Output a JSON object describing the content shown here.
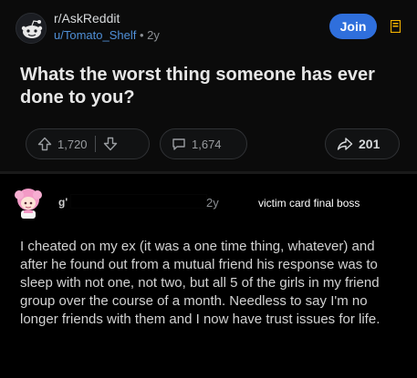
{
  "post": {
    "subreddit": "r/AskReddit",
    "author": "u/Tomato_Shelf",
    "separator": "•",
    "age": "2y",
    "join_label": "Join",
    "title": "Whats the worst thing someone has ever done to you?",
    "upvotes": "1,720",
    "comments": "1,674",
    "shares": "201"
  },
  "comment": {
    "user_prefix": "g'",
    "age": "2y",
    "overlay_note": "victim card final boss",
    "body": "I cheated on my ex (it was a one time thing, whatever) and after he found out from a mutual friend his response was to sleep with not one, not two, but all 5 of the girls in my friend group over the course of a month. Needless to say I'm no longer friends with them and I now have trust issues for life."
  },
  "icons": {
    "subreddit": "reddit-alien-icon",
    "bookmark": "bookmark-icon",
    "upvote": "upvote-arrow-icon",
    "downvote": "downvote-arrow-icon",
    "comment": "comment-bubble-icon",
    "share": "share-arrow-icon",
    "avatar": "anime-avatar-icon"
  },
  "colors": {
    "join_button": "#2f6fdc",
    "author_link": "#4f8fd6",
    "bookmark": "#f4b400"
  }
}
